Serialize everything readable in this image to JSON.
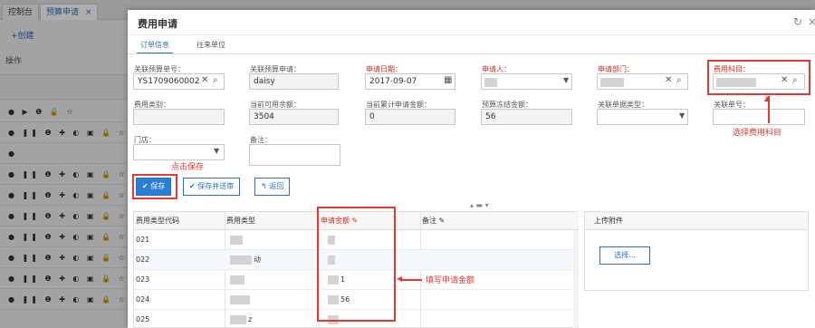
{
  "background": {
    "tabs": [
      "控制台",
      "预算申请"
    ],
    "tab_close": "×",
    "create_label": "+创建",
    "operation_label": "操作",
    "rows": [
      {
        "icons": "● ▶ ❶ 🔒 ☆"
      },
      {
        "icons": "● ❚❚ ❶ ✚ ◐ ▣ 🔒 ☆"
      },
      {
        "icons": "●"
      },
      {
        "icons": "● ❚❚ ❶ ✚ ◐ ▣ 🔒 ☆"
      },
      {
        "icons": "● ❚❚ ❶ ✚ ◐ ▣ 🔒 ☆"
      },
      {
        "icons": "● ❚❚ ❶ ✚ ◐ ▣ 🔒 ☆"
      },
      {
        "icons": "● ❚❚ ❶ ✚ ◐ ▣ 🔒 ☆"
      },
      {
        "icons": "● ❚❚ ❶ ✚ ◐ ▣ 🔒 ☆"
      },
      {
        "icons": "● ❚❚ ❶ ✚ ◐ ▣ 🔒 ☆"
      },
      {
        "icons": "● ❚❚ ❶ ✚ ◐ ▣ 🔒 ☆"
      }
    ]
  },
  "modal": {
    "title": "费用申请",
    "tabs": [
      "订单信息",
      "往来单位"
    ],
    "form": {
      "budget_no": {
        "label": "关联预算单号：",
        "value": "YS1709060002"
      },
      "budget_app": {
        "label": "关联预算申请：",
        "value": "daisy"
      },
      "apply_date": {
        "label": "申请日期：",
        "value": "2017-09-07"
      },
      "applicant": {
        "label": "申请人：",
        "value": ""
      },
      "department": {
        "label": "申请部门：",
        "value": ""
      },
      "subject": {
        "label": "费用科目：",
        "value": ""
      },
      "category": {
        "label": "费用类别：",
        "value": ""
      },
      "available": {
        "label": "当前可用余额：",
        "value": "3504"
      },
      "accum": {
        "label": "当前累计申请金额：",
        "value": "0"
      },
      "frozen": {
        "label": "预算冻结金额：",
        "value": "56"
      },
      "doc_type": {
        "label": "关联单据类型：",
        "value": ""
      },
      "doc_no": {
        "label": "关联单号：",
        "value": ""
      },
      "store": {
        "label": "门店：",
        "value": ""
      },
      "remark": {
        "label": "备注：",
        "value": ""
      }
    },
    "buttons": {
      "save": "保存",
      "save_submit": "保存并送审",
      "back": "返回"
    },
    "grid": {
      "headers": [
        "费用类型代码",
        "费用类型",
        "申请金额",
        "备注"
      ],
      "rows": [
        {
          "code": "021",
          "type": "",
          "amount": "",
          "remark": ""
        },
        {
          "code": "022",
          "type": "动",
          "amount": "",
          "remark": ""
        },
        {
          "code": "023",
          "type": "",
          "amount": "1",
          "remark": ""
        },
        {
          "code": "024",
          "type": "",
          "amount": "56",
          "remark": ""
        },
        {
          "code": "025",
          "type": "z",
          "amount": "",
          "remark": ""
        }
      ]
    },
    "upload": {
      "title": "上传附件",
      "button": "选择..."
    }
  },
  "annotations": {
    "save_hint": "点击保存",
    "subject_hint": "选择费用科目",
    "amount_hint": "填写申请金额"
  },
  "colors": {
    "accent": "#2a6fc9",
    "required": "#d9281e",
    "annotation": "#e53935"
  }
}
